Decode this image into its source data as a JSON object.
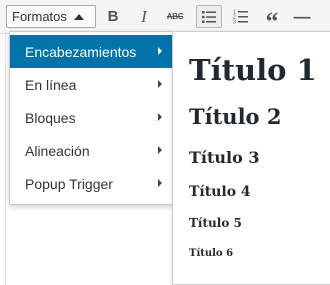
{
  "toolbar": {
    "formats_label": "Formatos",
    "bold_glyph": "B",
    "italic_glyph": "I",
    "strike_glyph": "ABC",
    "quote_glyph": "“",
    "more_glyph": "—"
  },
  "menu": {
    "items": [
      {
        "label": "Encabezamientos",
        "active": true
      },
      {
        "label": "En línea"
      },
      {
        "label": "Bloques"
      },
      {
        "label": "Alineación"
      },
      {
        "label": "Popup Trigger"
      }
    ]
  },
  "submenu": {
    "items": [
      {
        "label": "Título 1"
      },
      {
        "label": "Título 2"
      },
      {
        "label": "Título 3"
      },
      {
        "label": "Título 4"
      },
      {
        "label": "Título 5"
      },
      {
        "label": "Título 6"
      }
    ]
  },
  "colors": {
    "active_bg": "#0073aa",
    "active_text": "#ffffff",
    "menu_text": "#333333",
    "heading_text": "#23282d"
  },
  "icons": [
    "caret-up-icon",
    "bold-icon",
    "italic-icon",
    "strikethrough-icon",
    "bullet-list-icon",
    "numbered-list-icon",
    "blockquote-icon",
    "horizontal-line-icon",
    "caret-right-icon"
  ]
}
